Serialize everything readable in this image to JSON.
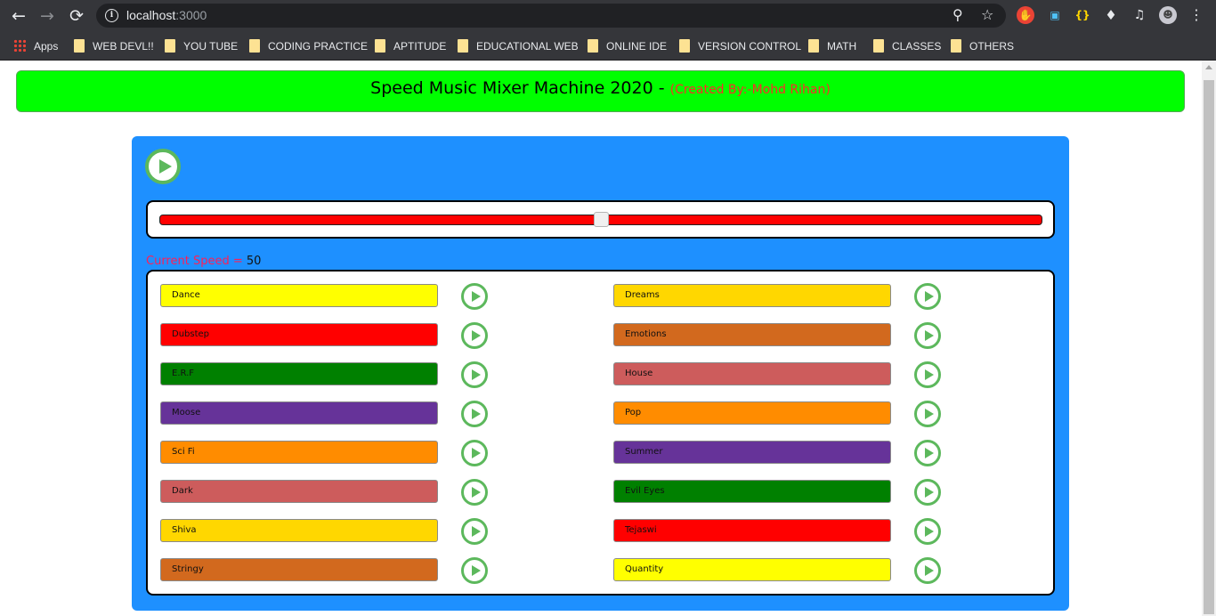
{
  "browser": {
    "url_host": "localhost",
    "url_port": ":3000",
    "bookmarks": [
      "Apps",
      "WEB DEVL!!",
      "YOU TUBE",
      "CODING PRACTICE",
      "APTITUDE",
      "EDUCATIONAL WEB",
      "ONLINE IDE",
      "VERSION CONTROL",
      "MATH",
      "CLASSES",
      "OTHERS"
    ],
    "icons": {
      "back": "back-arrow-icon",
      "forward": "forward-arrow-icon",
      "reload": "reload-icon",
      "info": "info-icon",
      "zoom": "zoom-icon",
      "star": "bookmark-star-icon",
      "extensions": "puzzle-icon",
      "media": "media-queue-icon",
      "menu": "kebab-menu-icon"
    }
  },
  "header": {
    "title": "Speed Music Mixer Machine 2020 - ",
    "credit": "(Created By:-Mohd Rihan)",
    "bg_color": "#00ff00"
  },
  "controls": {
    "speed_label": "Current Speed = ",
    "speed_value": "50",
    "slider_fraction": 0.5,
    "slider_color": "#ff0000"
  },
  "tracks_left": [
    {
      "label": "Dance",
      "color": "#ffff00"
    },
    {
      "label": "Dubstep",
      "color": "#ff0000"
    },
    {
      "label": "E.R.F",
      "color": "#008000"
    },
    {
      "label": "Moose",
      "color": "#663399"
    },
    {
      "label": "Sci Fi",
      "color": "#ff8c00"
    },
    {
      "label": "Dark",
      "color": "#cd5c5c"
    },
    {
      "label": "Shiva",
      "color": "#ffd700"
    },
    {
      "label": "Stringy",
      "color": "#d2691e"
    }
  ],
  "tracks_right": [
    {
      "label": "Dreams",
      "color": "#ffd700"
    },
    {
      "label": "Emotions",
      "color": "#d2691e"
    },
    {
      "label": "House",
      "color": "#cd5c5c"
    },
    {
      "label": "Pop",
      "color": "#ff8c00"
    },
    {
      "label": "Summer",
      "color": "#663399"
    },
    {
      "label": "Evil Eyes",
      "color": "#008000"
    },
    {
      "label": "Tejaswi",
      "color": "#ff0000"
    },
    {
      "label": "Quantity",
      "color": "#ffff00"
    }
  ]
}
